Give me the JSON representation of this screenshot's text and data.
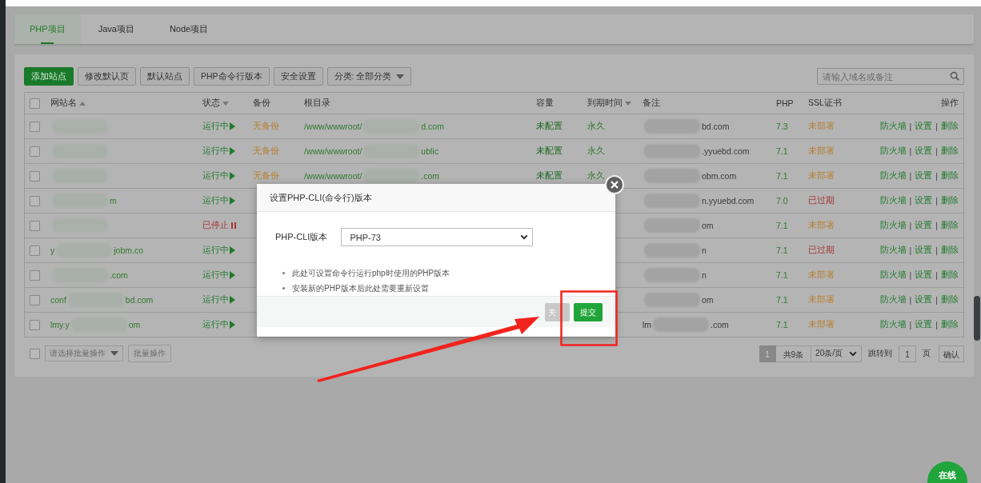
{
  "tabs": [
    {
      "label": "PHP项目",
      "selected": true
    },
    {
      "label": "Java项目",
      "selected": false
    },
    {
      "label": "Node项目",
      "selected": false
    }
  ],
  "toolbar": {
    "buttons": [
      {
        "label": "添加站点",
        "kind": "primary"
      },
      {
        "label": "修改默认页",
        "kind": "default"
      },
      {
        "label": "默认站点",
        "kind": "default"
      },
      {
        "label": "PHP命令行版本",
        "kind": "default"
      },
      {
        "label": "安全设置",
        "kind": "default"
      },
      {
        "label": "分类: 全部分类",
        "kind": "dropdown"
      }
    ],
    "search": {
      "placeholder": "请输入域名或备注"
    }
  },
  "table": {
    "select_all_checked": false,
    "columns": [
      {
        "label": "网站名",
        "sortable": true,
        "ascending": true
      },
      {
        "label": "状态",
        "sortable": true,
        "ascending": false
      },
      {
        "label": "备份"
      },
      {
        "label": "根目录"
      },
      {
        "label": "容量"
      },
      {
        "label": "到期时间",
        "sortable": true,
        "ascending": false
      },
      {
        "label": "备注"
      },
      {
        "label": "PHP"
      },
      {
        "label": "SSL证书"
      },
      {
        "label": "操作"
      }
    ],
    "rows": [
      {
        "checked": false,
        "status": "运行中",
        "running": true,
        "backup": "无备份",
        "root_start": "/www/wwwroot/",
        "root_end": "d.com",
        "capacity": "未配置",
        "expiry": "永久",
        "note_end": "bd.com",
        "php": "7.3",
        "ssl": "未部署",
        "expired": false,
        "actions": [
          "防火墙",
          "|",
          "设置",
          "|",
          "删除"
        ]
      },
      {
        "checked": false,
        "status": "运行中",
        "running": true,
        "backup": "无备份",
        "root_start": "/www/wwwroot/",
        "root_end": "ublic",
        "capacity": "未配置",
        "expiry": "永久",
        "note_end": ".yyuebd.com",
        "php": "7.1",
        "ssl": "未部署",
        "expired": false,
        "actions": [
          "防火墙",
          "|",
          "设置",
          "|",
          "删除"
        ]
      },
      {
        "checked": false,
        "status": "运行中",
        "running": true,
        "backup": "无备份",
        "root_start": "/www/wwwroot/",
        "root_end": ".com",
        "capacity": "未配置",
        "expiry": "永久",
        "note_end": "obm.com",
        "php": "7.1",
        "ssl": "未部署",
        "expired": false,
        "actions": [
          "防火墙",
          "|",
          "设置",
          "|",
          "删除"
        ]
      },
      {
        "checked": false,
        "name_end": "m",
        "status": "运行中",
        "running": true,
        "note_end": "n.yyuebd.com",
        "php": "7.0",
        "ssl": "已过期",
        "expired": true,
        "actions": [
          "防火墙",
          "|",
          "设置",
          "|",
          "删除"
        ]
      },
      {
        "checked": false,
        "status": "已停止",
        "running": false,
        "note_end": "om",
        "php": "7.1",
        "ssl": "未部署",
        "expired": false,
        "actions": [
          "防火墙",
          "|",
          "设置",
          "|",
          "删除"
        ]
      },
      {
        "checked": false,
        "name_start": "y",
        "name_end": "jobm.co",
        "status": "运行中",
        "running": true,
        "note_end": "n",
        "php": "7.1",
        "ssl": "已过期",
        "expired": true,
        "actions": [
          "防火墙",
          "|",
          "设置",
          "|",
          "删除"
        ]
      },
      {
        "checked": false,
        "name_end": ".com",
        "status": "运行中",
        "running": true,
        "note_end": "n",
        "php": "7.1",
        "ssl": "未部署",
        "expired": false,
        "actions": [
          "防火墙",
          "|",
          "设置",
          "|",
          "删除"
        ]
      },
      {
        "checked": false,
        "name_start": "conf",
        "name_end": "bd.com",
        "status": "运行中",
        "running": true,
        "note_end": "om",
        "php": "7.1",
        "ssl": "未部署",
        "expired": false,
        "actions": [
          "防火墙",
          "|",
          "设置",
          "|",
          "删除"
        ]
      },
      {
        "checked": false,
        "name_start": "lmy.y",
        "name_end": "om",
        "status": "运行中",
        "running": true,
        "note_start": "lm",
        "note_end": ".com",
        "php": "7.1",
        "ssl": "未部署",
        "expired": false,
        "actions": [
          "防火墙",
          "|",
          "设置",
          "|",
          "删除"
        ]
      }
    ]
  },
  "footer": {
    "select_all_checked": false,
    "bulk_select": {
      "placeholder": "请选择批量操作"
    },
    "bulk_button": "批量操作",
    "pagination": {
      "pages": [
        {
          "label": "1",
          "selected": true
        }
      ],
      "total": "共9条",
      "per_page": "20条/页",
      "jump_label": "跳转到",
      "jump_value": "1",
      "jump_unit": "页",
      "confirm": "确认"
    }
  },
  "dialog": {
    "title": "设置PHP-CLI(命令行)版本",
    "field_label": "PHP-CLI版本",
    "field_value": "PHP-73",
    "notes": [
      "此处可设置命令行运行php时使用的PHP版本",
      "安装新的PHP版本后此处需要重新设置"
    ],
    "buttons": [
      {
        "label": "关",
        "kind": "close"
      },
      {
        "label": "提交",
        "kind": "submit"
      }
    ]
  },
  "chat_button": {
    "label": "在线"
  }
}
